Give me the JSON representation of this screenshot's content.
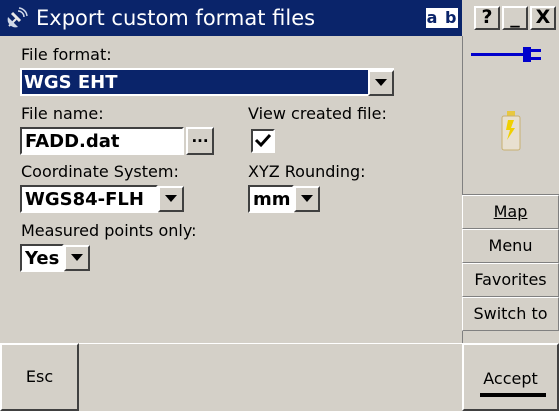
{
  "title": "Export custom format files",
  "input_mode": "a b",
  "caption_buttons": {
    "help": "?",
    "minimize": "_",
    "close": "X"
  },
  "file_format": {
    "label": "File format:",
    "value": "WGS EHT"
  },
  "file_name": {
    "label": "File name:",
    "value": "FADD.dat",
    "browse": "..."
  },
  "view_created_file": {
    "label": "View created file:",
    "checked": true
  },
  "coordinate_system": {
    "label": "Coordinate System:",
    "value": "WGS84-FLH"
  },
  "xyz_rounding": {
    "label": "XYZ Rounding:",
    "value": "mm"
  },
  "measured_points_only": {
    "label": "Measured points only:",
    "value": "Yes"
  },
  "sidebar": {
    "buttons": [
      "Map",
      "Menu",
      "Favorites",
      "Switch to"
    ]
  },
  "bottom": {
    "esc": "Esc",
    "accept": "Accept"
  },
  "colors": {
    "titlebar": "#0a246a",
    "face": "#d4d0c8",
    "highlight": "#0a246a"
  },
  "icons": [
    "app-satellite-icon",
    "power-plug-icon",
    "battery-icon",
    "dropdown-arrow-icon",
    "checkmark-icon"
  ]
}
